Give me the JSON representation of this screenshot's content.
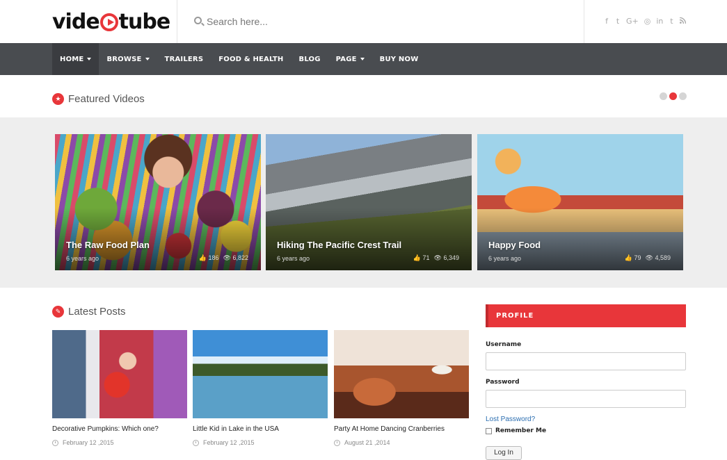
{
  "header": {
    "logo_left": "vide",
    "logo_right": "tube",
    "search_placeholder": "Search here...",
    "social": [
      "f",
      "t",
      "G+",
      "◎",
      "in",
      "t",
      "rss"
    ]
  },
  "nav": {
    "items": [
      {
        "label": "HOME",
        "dropdown": true,
        "active": true
      },
      {
        "label": "BROWSE",
        "dropdown": true
      },
      {
        "label": "TRAILERS"
      },
      {
        "label": "FOOD & HEALTH"
      },
      {
        "label": "BLOG"
      },
      {
        "label": "PAGE",
        "dropdown": true
      },
      {
        "label": "BUY NOW"
      }
    ]
  },
  "featured": {
    "heading": "Featured Videos",
    "cards": [
      {
        "title": "The Raw Food Plan",
        "age": "6 years ago",
        "likes": "186",
        "views": "6,822"
      },
      {
        "title": "Hiking The Pacific Crest Trail",
        "age": "6 years ago",
        "likes": "71",
        "views": "6,349"
      },
      {
        "title": "Happy Food",
        "age": "6 years ago",
        "likes": "79",
        "views": "4,589"
      }
    ]
  },
  "latest": {
    "heading": "Latest Posts",
    "posts": [
      {
        "title": "Decorative Pumpkins: Which one?",
        "date": "February 12 ,2015"
      },
      {
        "title": "Little Kid in Lake in the USA",
        "date": "February 12 ,2015"
      },
      {
        "title": "Party At Home Dancing Cranberries",
        "date": "August 21 ,2014"
      }
    ]
  },
  "profile": {
    "heading": "PROFILE",
    "username_label": "Username",
    "password_label": "Password",
    "lost_password": "Lost Password?",
    "remember_me": "Remember Me",
    "login_button": "Log In"
  },
  "colors": {
    "accent": "#e8363a",
    "nav_bg": "#494c50"
  }
}
